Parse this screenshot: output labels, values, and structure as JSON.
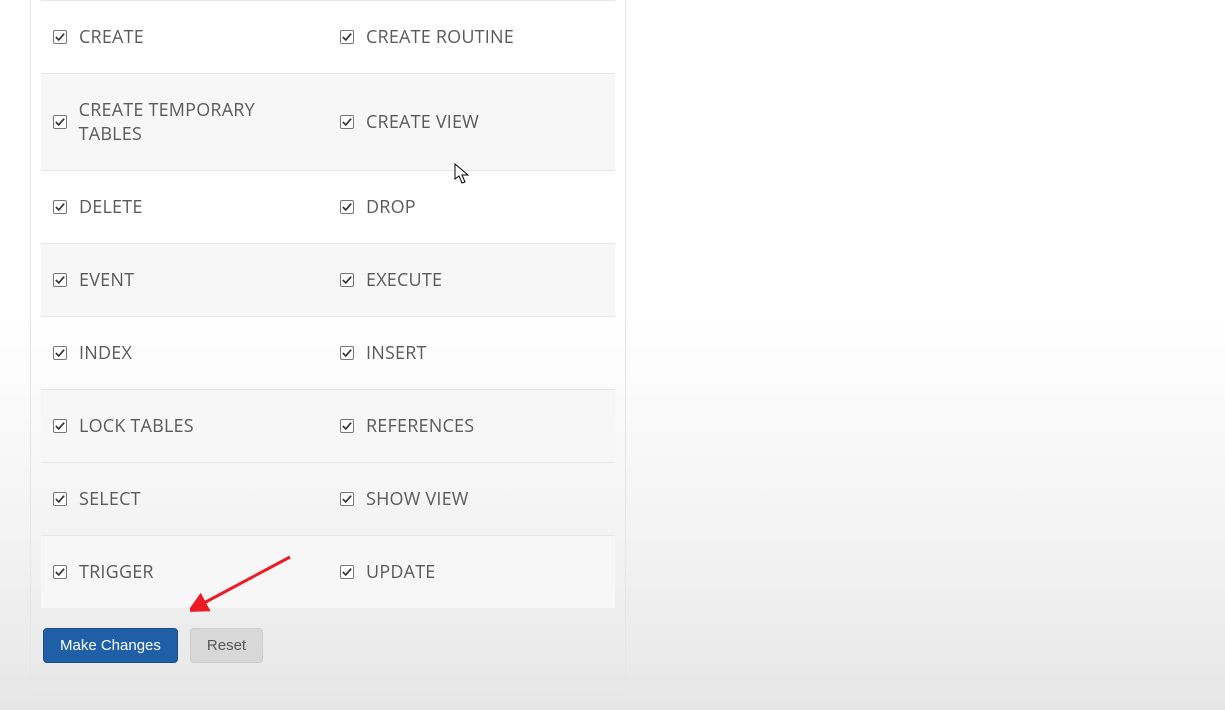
{
  "privileges": {
    "rows": [
      {
        "left": "CREATE",
        "right": "CREATE ROUTINE"
      },
      {
        "left": "CREATE TEMPORARY TABLES",
        "right": "CREATE VIEW"
      },
      {
        "left": "DELETE",
        "right": "DROP"
      },
      {
        "left": "EVENT",
        "right": "EXECUTE"
      },
      {
        "left": "INDEX",
        "right": "INSERT"
      },
      {
        "left": "LOCK TABLES",
        "right": "REFERENCES"
      },
      {
        "left": "SELECT",
        "right": "SHOW VIEW"
      },
      {
        "left": "TRIGGER",
        "right": "UPDATE"
      }
    ]
  },
  "buttons": {
    "primary": "Make Changes",
    "reset": "Reset"
  },
  "colors": {
    "primary": "#1f5fa8",
    "arrow": "#ed1c24"
  }
}
